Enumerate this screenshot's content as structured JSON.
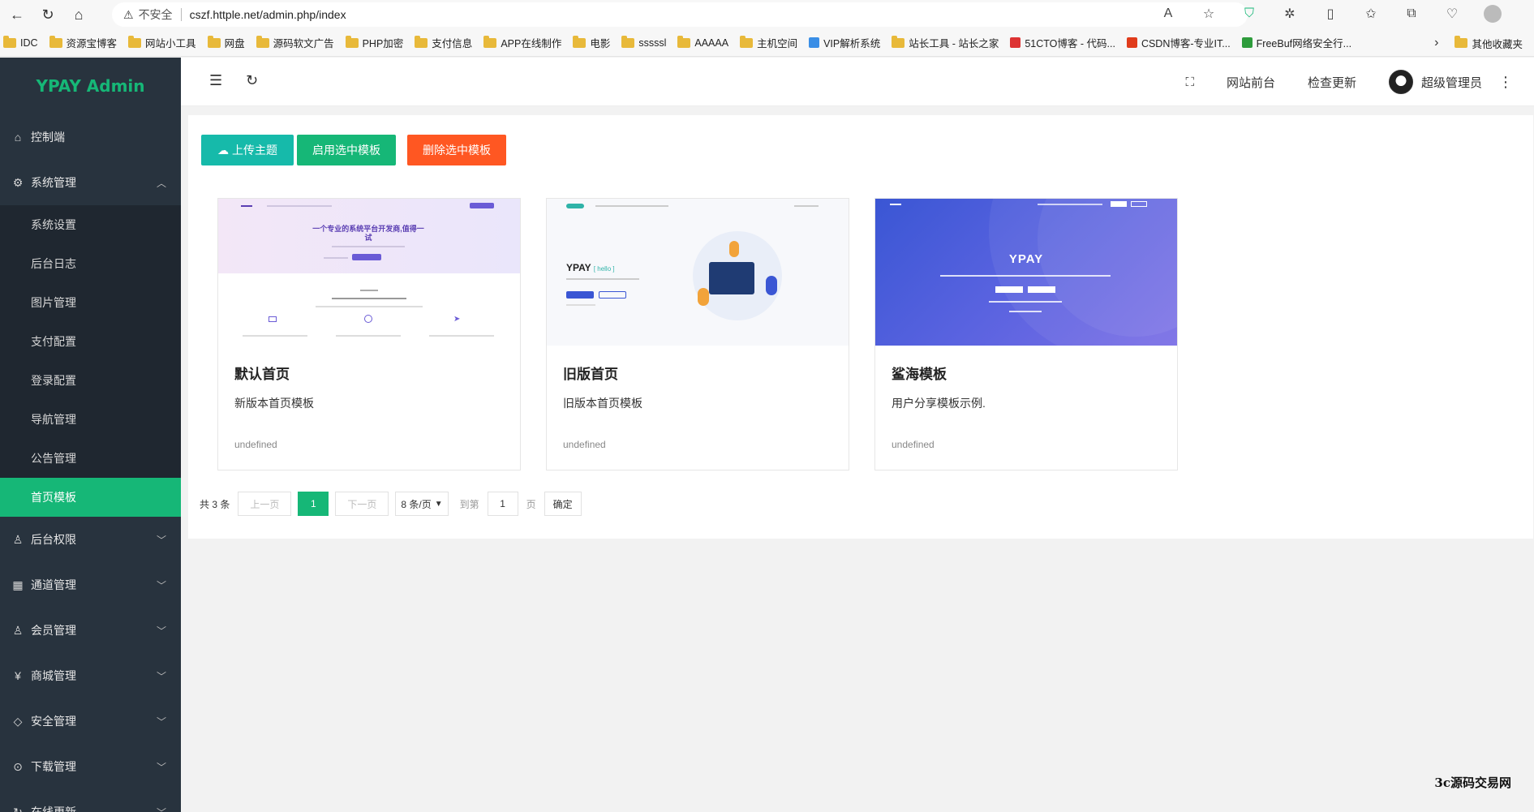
{
  "browser": {
    "insecure_label": "不安全",
    "url": "cszf.httple.net/admin.php/index",
    "bookmarks": [
      "IDC",
      "资源宝博客",
      "网站小工具",
      "网盘",
      "源码软文广告",
      "PHP加密",
      "支付信息",
      "APP在线制作",
      "电影",
      "sssssl",
      "AAAAA",
      "主机空间",
      "VIP解析系统",
      "站长工具 - 站长之家",
      "51CTO博客 - 代码...",
      "CSDN博客-专业IT...",
      "FreeBuf网络安全行..."
    ],
    "bookmarks_more": "其他收藏夹"
  },
  "sidebar": {
    "logo": "YPAY Admin",
    "items": [
      {
        "label": "控制端",
        "icon": "home-icon"
      },
      {
        "label": "系统管理",
        "icon": "gear-icon",
        "expanded": true,
        "children": [
          "系统设置",
          "后台日志",
          "图片管理",
          "支付配置",
          "登录配置",
          "导航管理",
          "公告管理",
          "首页模板"
        ]
      },
      {
        "label": "后台权限",
        "icon": "user-icon"
      },
      {
        "label": "通道管理",
        "icon": "apps-icon"
      },
      {
        "label": "会员管理",
        "icon": "user-icon"
      },
      {
        "label": "商城管理",
        "icon": "yen-icon"
      },
      {
        "label": "安全管理",
        "icon": "diamond-icon"
      },
      {
        "label": "下载管理",
        "icon": "download-icon"
      },
      {
        "label": "在线更新",
        "icon": "refresh-icon"
      }
    ],
    "active_child": "首页模板"
  },
  "header": {
    "links": [
      "网站前台",
      "检查更新"
    ],
    "user": "超级管理员"
  },
  "toolbar": {
    "upload_label": "上传主题",
    "enable_label": "启用选中模板",
    "delete_label": "删除选中模板"
  },
  "cards": [
    {
      "title": "默认首页",
      "desc": "新版本首页模板",
      "meta": "undefined",
      "thumb_text": "一个专业的系统平台开发商,值得一试"
    },
    {
      "title": "旧版首页",
      "desc": "旧版本首页模板",
      "meta": "undefined",
      "thumb_text": "YPAY",
      "thumb_sub": "[ hello ]"
    },
    {
      "title": "鲨海模板",
      "desc": "用户分享模板示例.",
      "meta": "undefined",
      "thumb_text": "YPAY"
    }
  ],
  "pagination": {
    "total": "共 3 条",
    "prev": "上一页",
    "current": "1",
    "next": "下一页",
    "page_size": "8 条/页",
    "goto_label": "到第",
    "goto_value": "1",
    "page_unit": "页",
    "confirm": "确定"
  },
  "watermark": "3c源码交易网",
  "colors": {
    "accent": "#16b777",
    "teal": "#16baaa",
    "danger": "#ff5722",
    "sidebar": "#28333e"
  }
}
